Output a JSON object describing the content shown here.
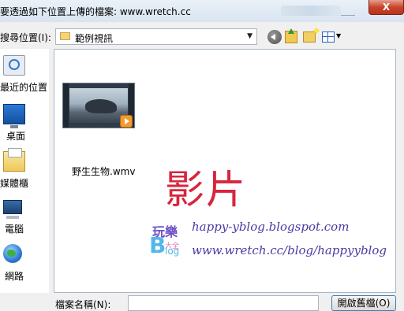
{
  "window": {
    "title": "要透過如下位置上傳的檔案: www.wretch.cc",
    "close_label": "X"
  },
  "toolbar": {
    "look_in_label": "搜尋位置(I):",
    "look_in_value": "範例視訊",
    "icons": [
      "back-icon",
      "up-folder-icon",
      "new-folder-icon",
      "view-menu-icon"
    ]
  },
  "places": [
    {
      "label": "最近的位置",
      "icon": "recent-places-icon"
    },
    {
      "label": "桌面",
      "icon": "desktop-icon"
    },
    {
      "label": "媒體櫃",
      "icon": "libraries-icon"
    },
    {
      "label": "電腦",
      "icon": "computer-icon"
    },
    {
      "label": "網路",
      "icon": "network-icon"
    }
  ],
  "files": [
    {
      "name": "野生生物.wmv",
      "icon": "video-file-icon"
    }
  ],
  "watermark": {
    "title": "影片",
    "logo_top": "玩樂",
    "logo_letter": "B",
    "logo_small": "大全",
    "logo_log": "log",
    "blog_line": "happy-yblog.blogspot.com",
    "url_line": "www.wretch.cc/blog/happyyblog"
  },
  "footer": {
    "filename_label": "檔案名稱(N):",
    "filename_value": "",
    "open_label": "開啟舊檔(O)"
  }
}
